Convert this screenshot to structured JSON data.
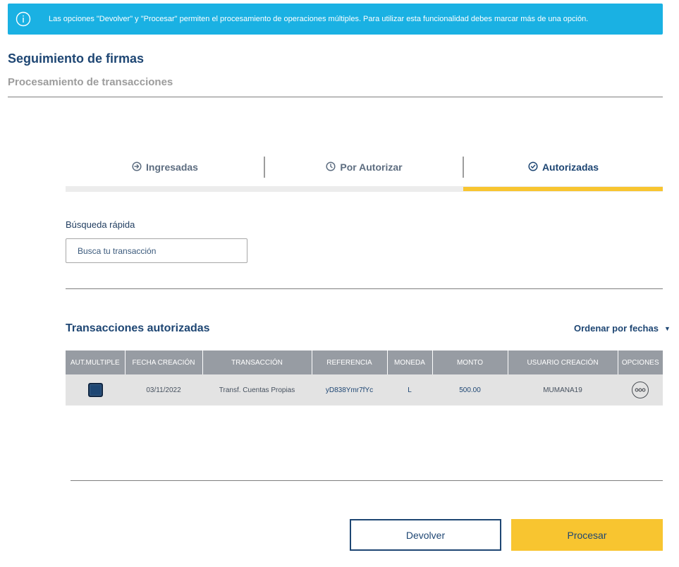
{
  "banner": {
    "icon": "info-icon",
    "text": "Las opciones \"Devolver\" y \"Procesar\" permiten el procesamiento de operaciones múltiples. Para utilizar esta funcionalidad debes marcar más de una opción."
  },
  "header": {
    "title": "Seguimiento de firmas",
    "subtitle": "Procesamiento de transacciones"
  },
  "tabs": [
    {
      "label": "Ingresadas",
      "icon": "arrow-circle-right-icon",
      "active": false
    },
    {
      "label": "Por Autorizar",
      "icon": "clock-icon",
      "active": false
    },
    {
      "label": "Autorizadas",
      "icon": "check-circle-icon",
      "active": true
    }
  ],
  "search": {
    "label": "Búsqueda rápida",
    "placeholder": "Busca tu transacción",
    "value": ""
  },
  "table_section": {
    "title": "Transacciones autorizadas",
    "sort_label": "Ordenar por fechas"
  },
  "table": {
    "columns": [
      "AUT.MULTIPLE",
      "FECHA CREACIÓN",
      "TRANSACCIÓN",
      "REFERENCIA",
      "MONEDA",
      "MONTO",
      "USUARIO CREACIÓN",
      "OPCIONES"
    ],
    "rows": [
      {
        "checked": true,
        "fecha": "03/11/2022",
        "transaccion": "Transf. Cuentas Propias",
        "referencia": "yD838Ymr7fYc",
        "moneda": "L",
        "monto": "500.00",
        "usuario": "MUMANA19"
      }
    ]
  },
  "actions": {
    "return_label": "Devolver",
    "process_label": "Procesar"
  },
  "colors": {
    "banner": "#1ab1e3",
    "brand_navy": "#1e4673",
    "accent_yellow": "#f8c530",
    "table_header": "#979ca3",
    "table_row": "#e3e3e3"
  }
}
